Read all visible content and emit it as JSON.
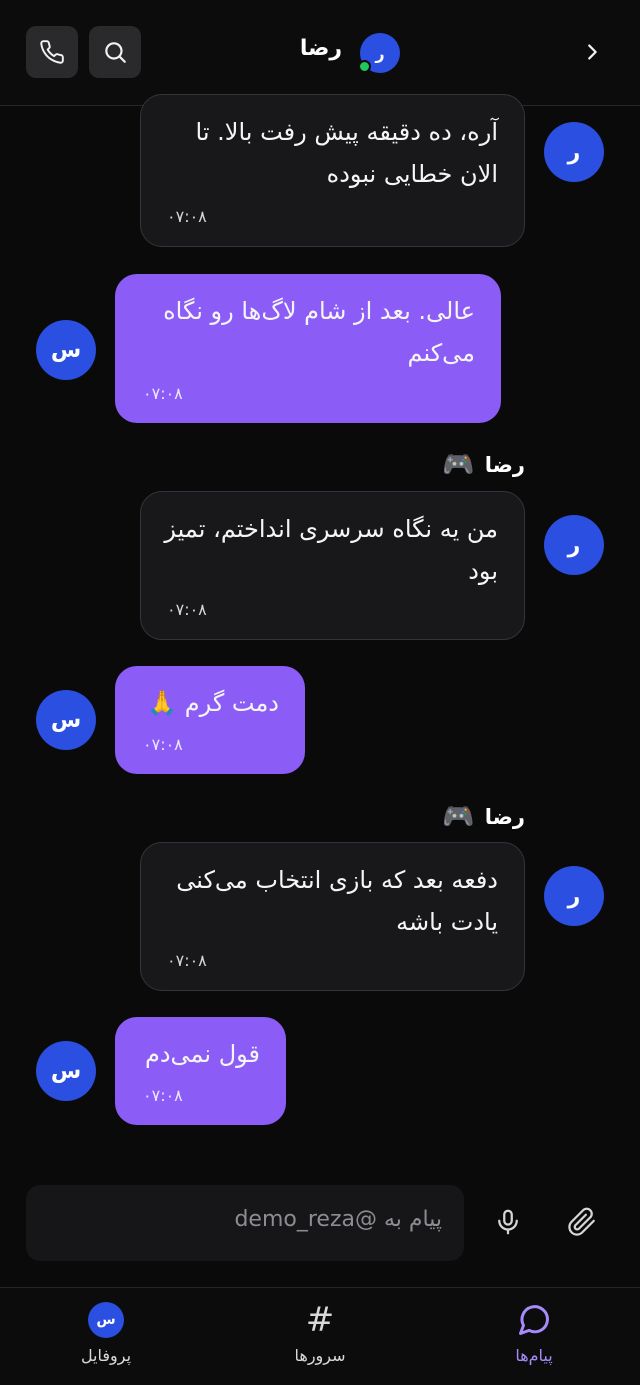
{
  "header": {
    "title": "رضا",
    "avatar_letter": "ر",
    "online_color": "#22c55e",
    "icons": {
      "call": "phone-icon",
      "search": "search-icon",
      "back": "chevron-right-icon"
    }
  },
  "messages": [
    {
      "direction": "incoming",
      "avatar": "ر",
      "text": "آره، ده دقیقه پیش رفت بالا. تا الان خطایی نبوده",
      "time": "۰۷:۰۸"
    },
    {
      "direction": "outgoing",
      "avatar": "س",
      "text": "عالی. بعد از شام لاگ‌ها رو نگاه می‌کنم",
      "time": "۰۷:۰۸"
    },
    {
      "direction": "incoming",
      "avatar": "ر",
      "sender": "رضا",
      "sender_icon": "🎮",
      "text": "من یه نگاه سرسری انداختم، تمیز بود",
      "time": "۰۷:۰۸"
    },
    {
      "direction": "outgoing",
      "avatar": "س",
      "text": "دمت گرم 🙏",
      "time": "۰۷:۰۸"
    },
    {
      "direction": "incoming",
      "avatar": "ر",
      "sender": "رضا",
      "sender_icon": "🎮",
      "text": "دفعه بعد که بازی انتخاب می‌کنی یادت باشه",
      "time": "۰۷:۰۸"
    },
    {
      "direction": "outgoing",
      "avatar": "س",
      "text": "قول نمی‌دم",
      "time": "۰۷:۰۸"
    }
  ],
  "composer": {
    "placeholder": "پیام به @demo_reza",
    "icons": {
      "mic": "microphone-icon",
      "attach": "paperclip-icon"
    }
  },
  "nav": {
    "profile": {
      "label": "پروفایل",
      "avatar": "س"
    },
    "servers": {
      "label": "سرورها",
      "icon": "#"
    },
    "messages": {
      "label": "پیام‌ها",
      "active": true
    }
  },
  "colors": {
    "accent": "#8b5cf6",
    "accent_text": "#a78bfa",
    "avatar_blue": "#2b4fe0",
    "incoming_bubble": "#18181b",
    "background": "#0a0a0b"
  }
}
